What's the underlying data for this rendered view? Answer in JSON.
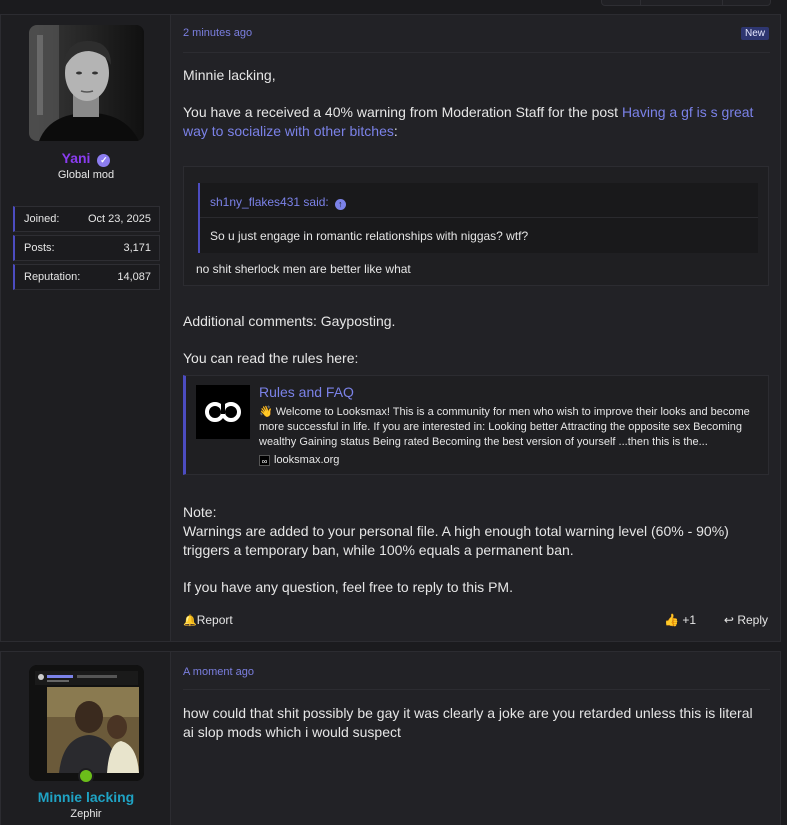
{
  "posts": [
    {
      "author": {
        "name": "Yani",
        "name_color": "#8a3cf0",
        "title": "Global mod",
        "stats": [
          {
            "label": "Joined:",
            "value": "Oct 23, 2025"
          },
          {
            "label": "Posts:",
            "value": "3,171"
          },
          {
            "label": "Reputation:",
            "value": "14,087"
          }
        ]
      },
      "timestamp": "2 minutes ago",
      "badge": "New",
      "greeting": "Minnie lacking,",
      "warning_prefix": "You have a received a 40% warning from Moderation Staff for the post ",
      "warning_link": "Having a gf is s great way to socialize with other bitches",
      "warning_suffix": ":",
      "quote": {
        "author_said": "sh1ny_flakes431 said:",
        "text": "So u just engage in romantic relationships with niggas? wtf?",
        "reply": "no shit sherlock men are better like what"
      },
      "additional_comments": "Additional comments: Gayposting.",
      "rules_intro": "You can read the rules here:",
      "unfurl": {
        "title": "Rules and FAQ",
        "description": "👋 Welcome to Looksmax! This is a community for men who wish to improve their looks and become more successful in life. If you are interested in: Looking better Attracting the opposite sex Becoming wealthy Gaining status Being rated Becoming the best version of yourself ...then this is the...",
        "domain": "looksmax.org"
      },
      "note_label": "Note:",
      "note_text": "Warnings are added to your personal file. A high enough total warning level (60% - 90%) triggers a temporary ban, while 100% equals a permanent ban.",
      "closing": "If you have any question, feel free to reply to this PM.",
      "actions": {
        "report": "Report",
        "like_count": "+1",
        "reply": "Reply"
      }
    },
    {
      "author": {
        "name": "Minnie lacking",
        "name_color": "#1fa3c4",
        "title": "Zephir",
        "online": true
      },
      "timestamp": "A moment ago",
      "text": "how could that shit possibly be gay it was clearly a joke are you retarded unless this is literal ai slop mods which i would suspect"
    }
  ]
}
